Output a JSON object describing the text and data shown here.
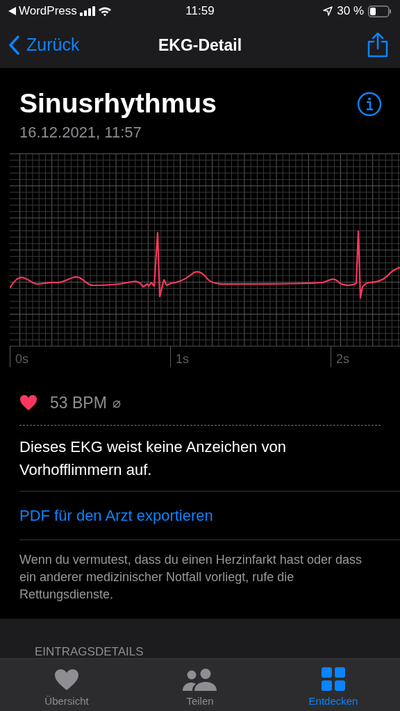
{
  "status_bar": {
    "back_app": "WordPress",
    "time": "11:59",
    "battery": "30 %"
  },
  "nav": {
    "back": "Zurück",
    "title": "EKG-Detail"
  },
  "header": {
    "title": "Sinusrhythmus",
    "date": "16.12.2021, 11:57"
  },
  "ecg": {
    "time_labels": [
      "0s",
      "1s",
      "2s"
    ]
  },
  "heart_rate": {
    "value": "53 BPM",
    "symbol": "⌀"
  },
  "result": "Dieses EKG weist keine Anzeichen von Vorhofflimmern auf.",
  "export_link": "PDF für den Arzt exportieren",
  "note": "Wenn du vermutest, dass du einen Herzinfarkt hast oder dass ein anderer medizinischer Notfall vorliegt, rufe die Rettungsdienste.",
  "section_heading": "EINTRAGSDETAILS",
  "tabs": [
    {
      "label": "Übersicht",
      "kind": "heart",
      "selected": false
    },
    {
      "label": "Teilen",
      "kind": "people",
      "selected": false
    },
    {
      "label": "Entdecken",
      "kind": "grid",
      "selected": true
    }
  ]
}
